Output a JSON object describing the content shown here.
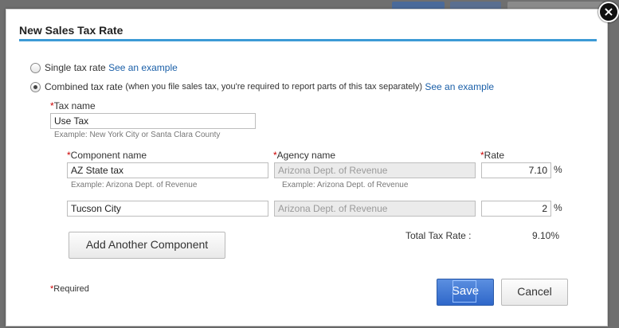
{
  "dialog": {
    "title": "New Sales Tax Rate",
    "close_symbol": "×"
  },
  "options": {
    "single": {
      "label": "Single tax rate",
      "link": "See an example",
      "checked": false
    },
    "combined": {
      "label": "Combined tax rate",
      "note": "(when you file sales tax, you're required to report parts of this tax separately)",
      "link": "See an example",
      "checked": true
    }
  },
  "form": {
    "required_mark": "*",
    "tax_name_label": "Tax name",
    "tax_name_value": "Use Tax",
    "tax_name_example": "Example: New York City or Santa Clara County",
    "component_label": "Component name",
    "agency_label": "Agency name",
    "rate_label": "Rate",
    "components": [
      {
        "name": "AZ State tax",
        "agency": "Arizona Dept. of Revenue",
        "rate": "7.10",
        "name_example": "Example: Arizona Dept. of Revenue",
        "agency_example": "Example: Arizona Dept. of Revenue"
      },
      {
        "name": "Tucson City",
        "agency": "Arizona Dept. of Revenue",
        "rate": "2"
      }
    ],
    "percent_sign": "%",
    "add_component_label": "Add Another Component",
    "total_label": "Total Tax Rate :",
    "total_value": "9.10%"
  },
  "footer": {
    "required_note": "Required",
    "save_label": "Save",
    "cancel_label": "Cancel"
  },
  "colors": {
    "accent": "#3c9ad6",
    "link": "#1a5fa8",
    "primary_button": "#2f67c9",
    "required": "#cc0000"
  }
}
